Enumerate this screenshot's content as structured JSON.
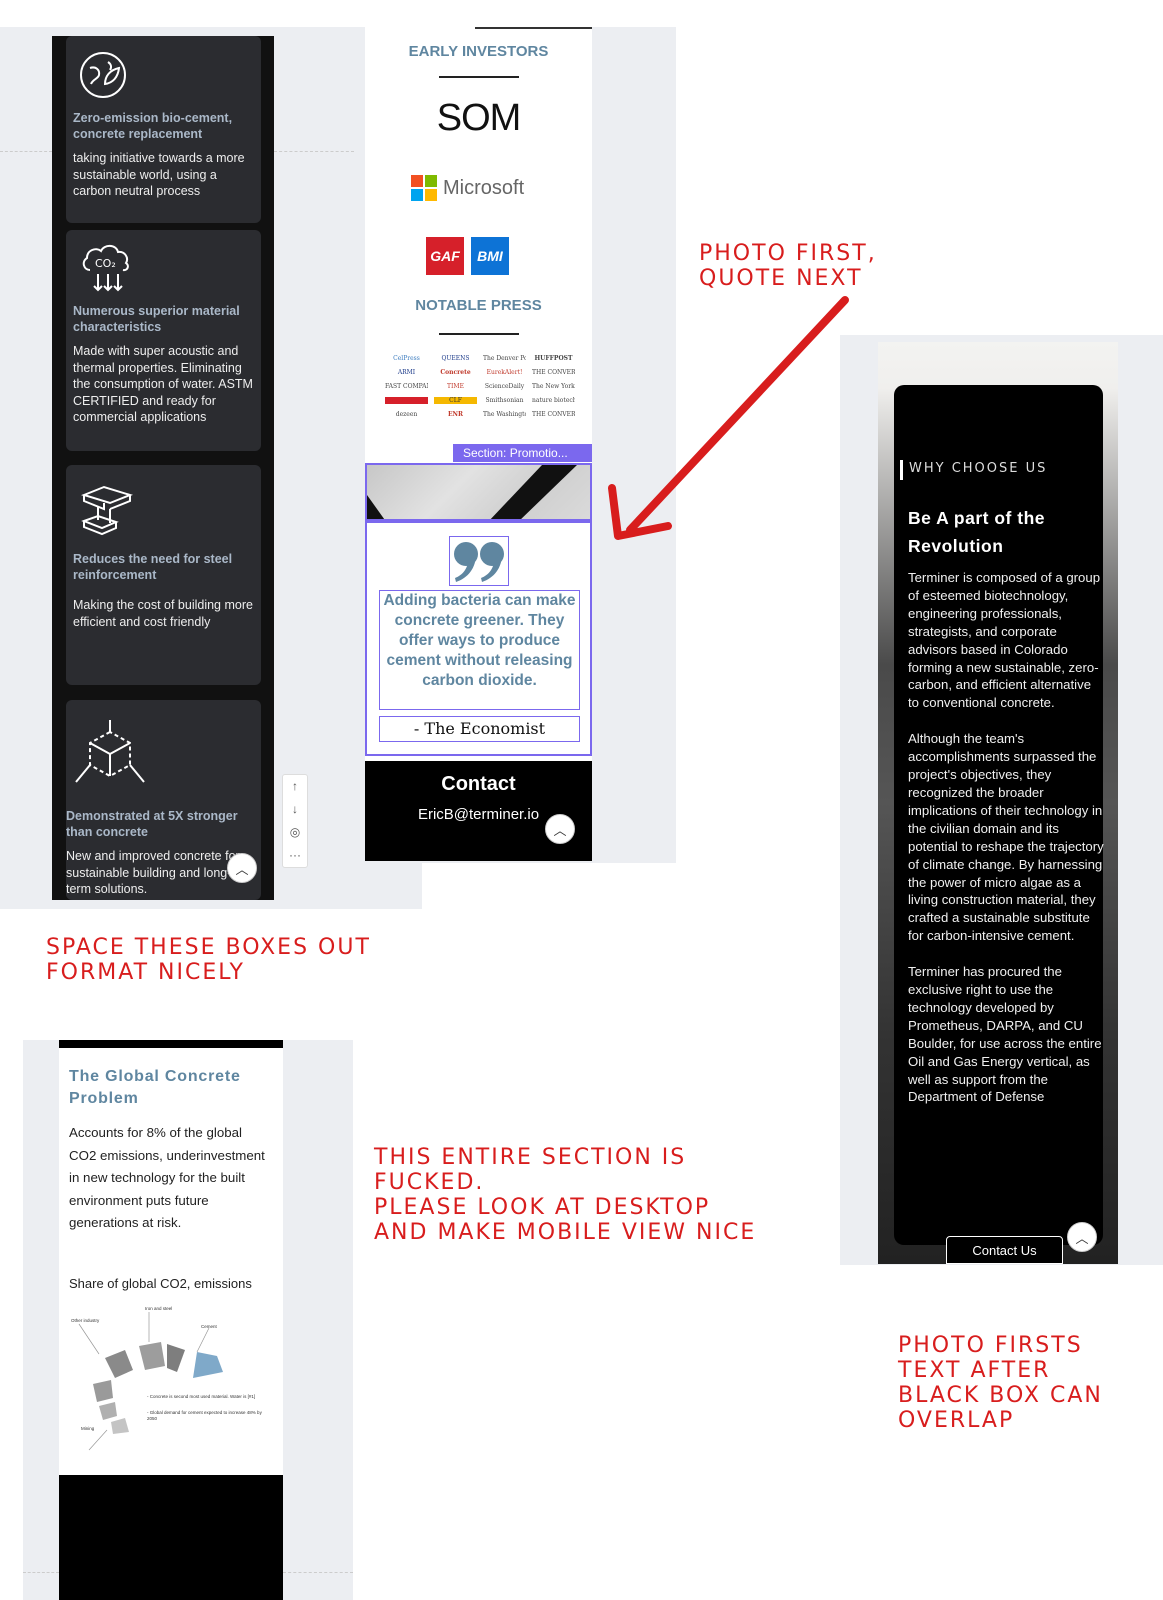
{
  "panel_features": {
    "cards": [
      {
        "title": "Zero-emission bio-cement, concrete replacement",
        "body": "taking initiative towards a more sustainable world, using a carbon neutral process",
        "icon": "leaf-globe-icon"
      },
      {
        "title": "Numerous superior material characteristics",
        "body": "Made with super acoustic and thermal properties. Eliminating the consumption of water. ASTM CERTIFIED and ready for commercial applications",
        "icon": "co2-cloud-icon"
      },
      {
        "title": "Reduces the need for steel reinforcement",
        "body": "Making the cost of building more efficient and cost friendly",
        "icon": "steel-beam-icon"
      },
      {
        "title": "Demonstrated at 5X stronger than concrete",
        "body": "New and improved concrete for sustainable building and long-term solutions.",
        "icon": "cube-icon"
      }
    ],
    "tools": [
      "↑",
      "↓",
      "◎",
      "···"
    ]
  },
  "panel_investors": {
    "early_investors": "EARLY INVESTORS",
    "logos": {
      "som": "SOM",
      "microsoft": "Microsoft",
      "gaf": "GAF",
      "bmi": "BMI"
    },
    "notable_press": "NOTABLE PRESS",
    "press_logos": [
      "CelPress",
      "QUEENS",
      "The Denver Post",
      "HUFFPOST",
      "ARMI",
      "Concrete",
      "EurekAlert!",
      "THE CONVERSATION",
      "FAST COMPANY",
      "TIME",
      "ScienceDaily",
      "The New York Times",
      "Smithsonian",
      "CLF",
      "Smithsonian",
      "nature biotechnology",
      "dezeen",
      "ENR",
      "The Washington Post",
      "THE CONVERSATION"
    ],
    "section_tag": "Section: Promotio...",
    "quote": "Adding bacteria can make concrete greener. They offer ways to produce cement without releasing carbon dioxide.",
    "quote_source": "- The Economist",
    "contact_heading": "Contact",
    "contact_email": "EricB@terminer.io"
  },
  "panel_why": {
    "eyebrow": "WHY CHOOSE US",
    "heading": "Be A part of the Revolution",
    "paragraphs": [
      "Terminer is composed of a group of esteemed biotechnology, engineering professionals, strategists, and corporate advisors based in Colorado forming a new sustainable, zero-carbon, and efficient alternative to conventional concrete.",
      "Although the team's accomplishments surpassed the project's objectives, they recognized the broader implications of their technology in the civilian domain and its potential to reshape the trajectory of climate change. By harnessing the power of micro algae as a living construction material, they crafted a sustainable substitute for carbon-intensive cement.",
      "Terminer has procured the exclusive right to use the technology developed by Prometheus, DARPA, and CU Boulder, for use across the entire Oil and Gas Energy vertical, as well as support from the Department of Defense"
    ],
    "button": "Contact Us"
  },
  "panel_problem": {
    "heading": "The Global Concrete Problem",
    "body": "Accounts for 8% of the global CO2 emissions, underinvestment in new technology for the built environment puts future generations at risk.",
    "chart_caption": "Share of global CO2, emissions",
    "chart_labels": [
      "Other industry",
      "Iron and steel",
      "Cement",
      "Mining"
    ],
    "chart_notes": [
      "- Concrete is second most used material. Water is [#1]",
      "- Global demand for cement expected to increase 48% by 2050"
    ]
  },
  "annotations": {
    "space_boxes": "SPACE THESE BOXES OUT\nFORMAT NICELY",
    "photo_first_quote": "PHOTO FIRST,\nQUOTE NEXT",
    "entire_section": "THIS ENTIRE SECTION IS\nFUCKED.\nPLEASE LOOK AT DESKTOP\nAND MAKE MOBILE VIEW NICE",
    "photo_firsts": "PHOTO FIRSTS\nTEXT AFTER\nBLACK BOX CAN\nOVERLAP"
  },
  "colors": {
    "accent_blue": "#5f86a0",
    "annotation_red": "#d81d1d",
    "selection_purple": "#7b68ee"
  }
}
